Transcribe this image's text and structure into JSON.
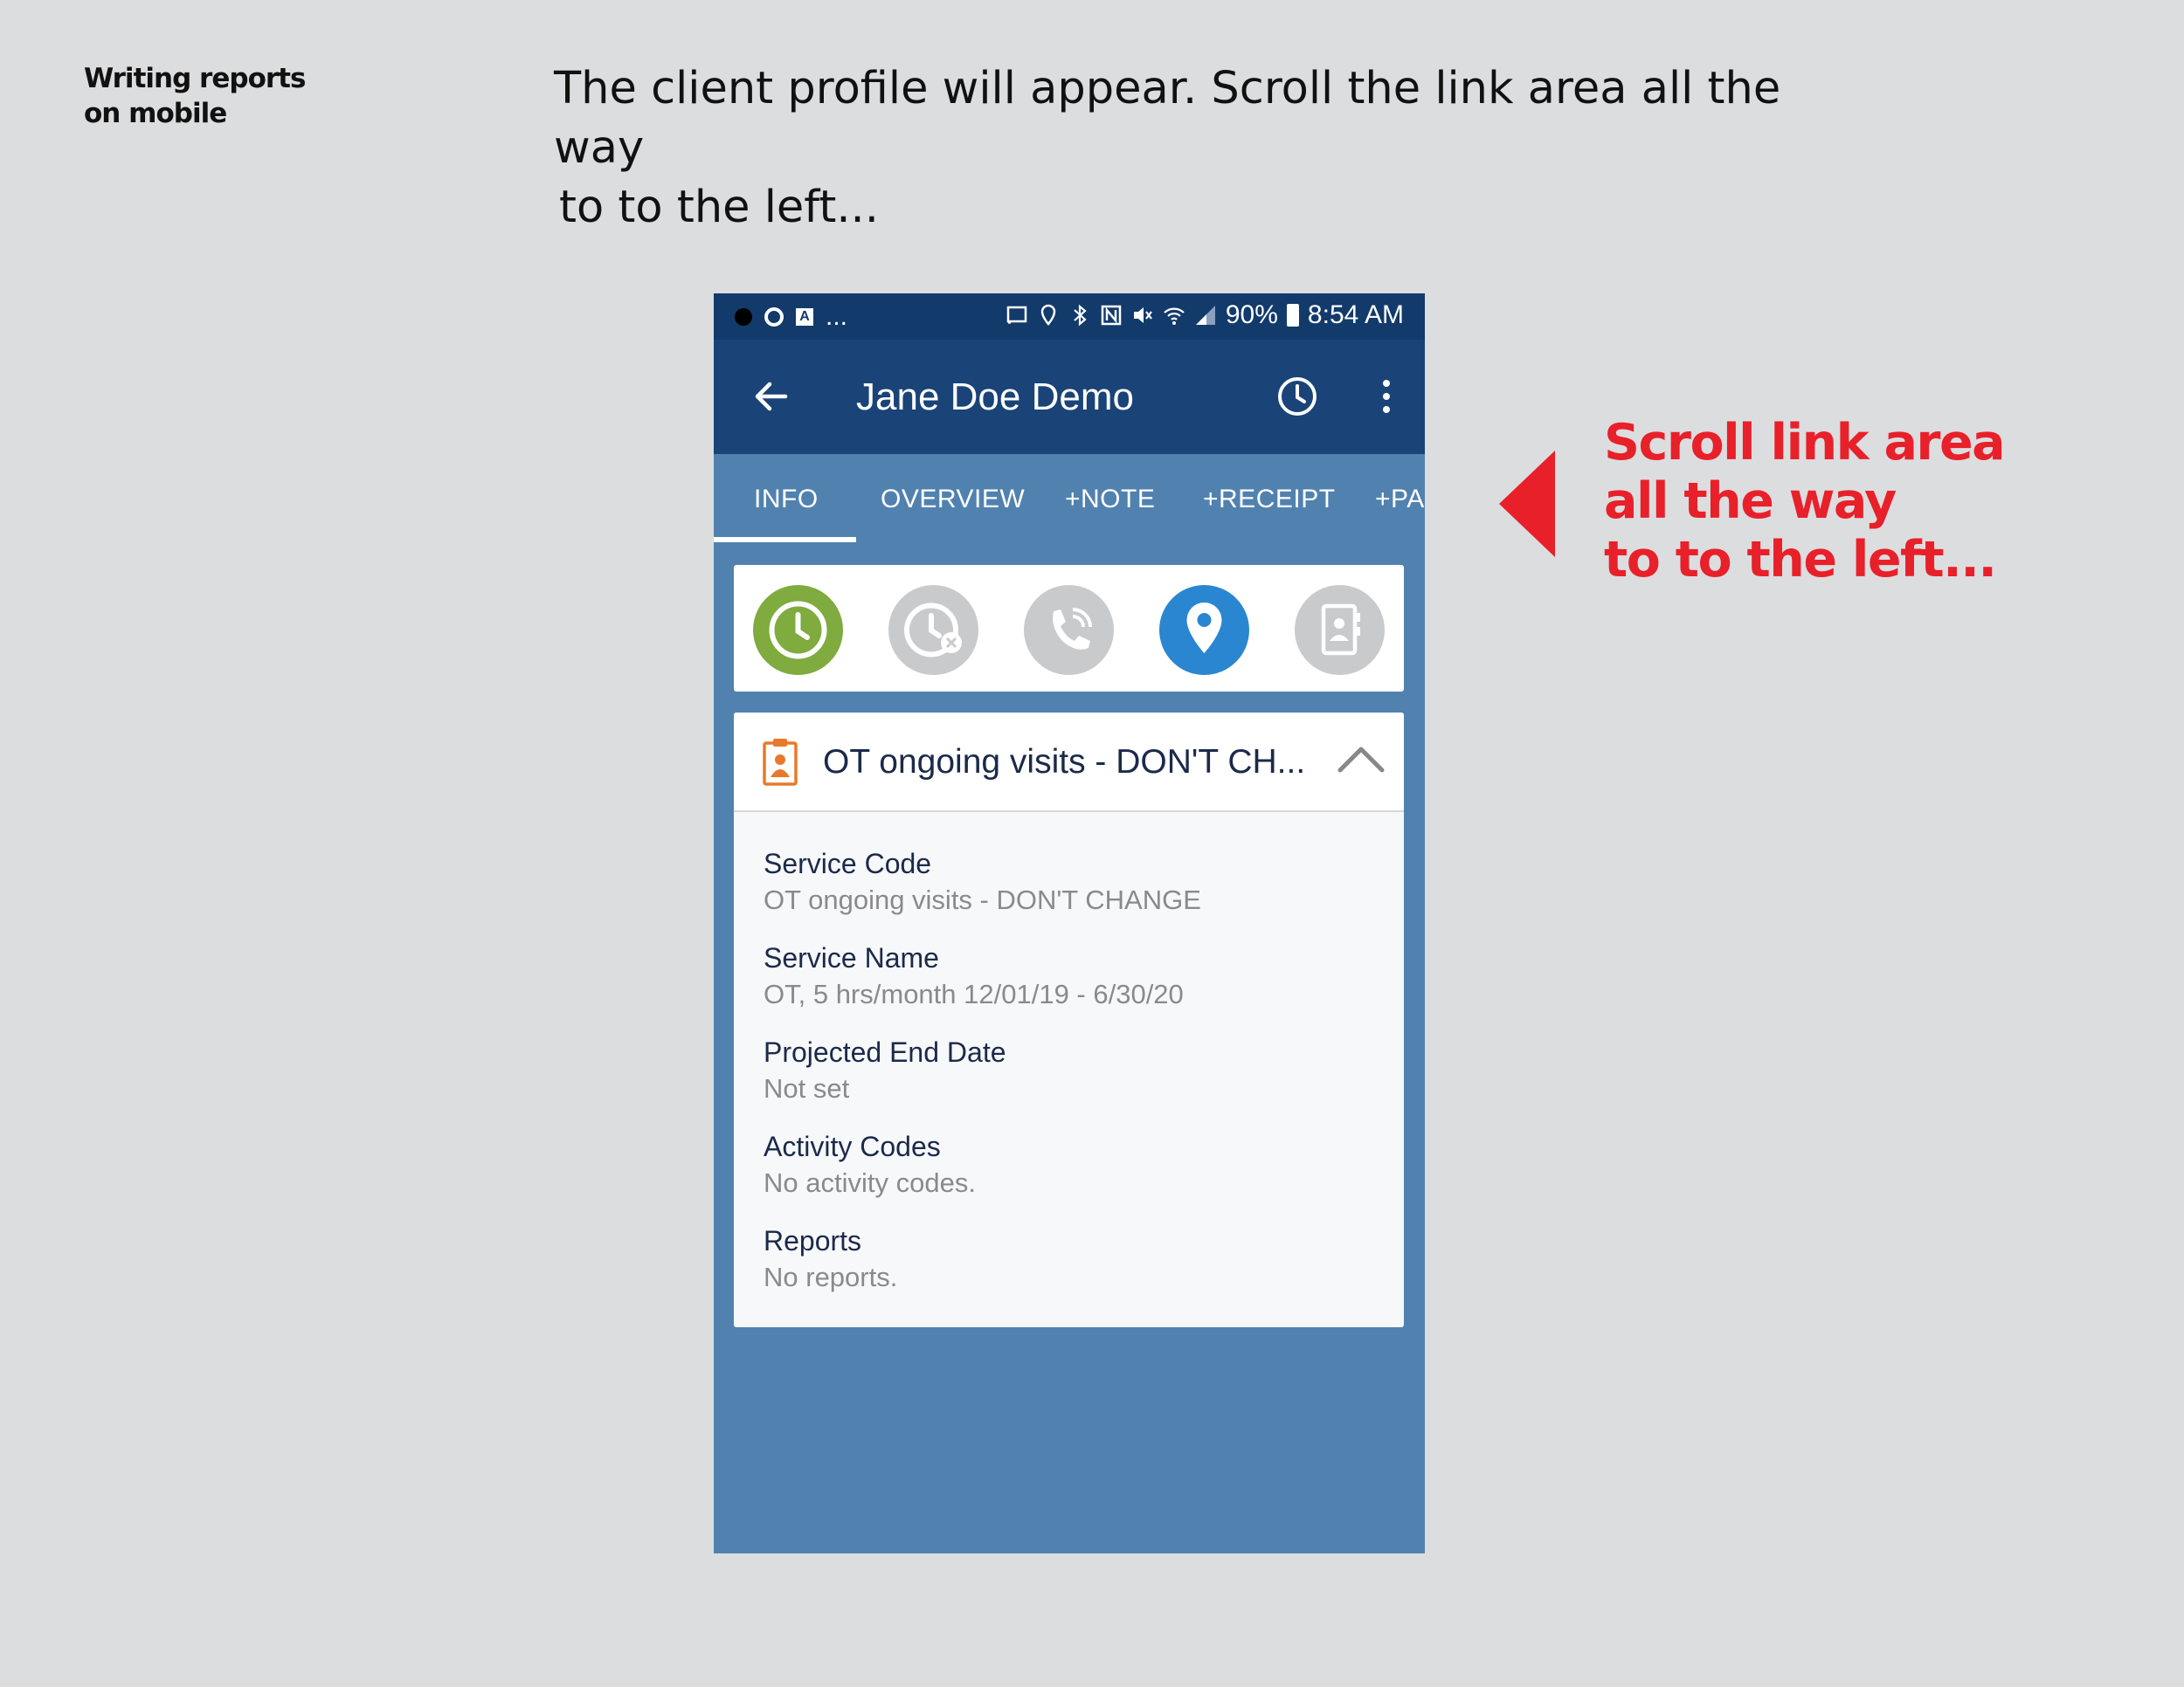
{
  "doc": {
    "side_title_line1": "Writing reports",
    "side_title_line2": "on mobile",
    "instruction_line1": "The client profile will appear. Scroll the link area all the way",
    "instruction_line2": "to to the left..."
  },
  "annotation": {
    "line1": "Scroll link area",
    "line2": "all the way",
    "line3": "to to the left...",
    "color": "#e8202a"
  },
  "status_bar": {
    "left_more": "...",
    "battery": "90%",
    "time": "8:54 AM"
  },
  "app_bar": {
    "title": "Jane Doe Demo",
    "color": "#1a4377"
  },
  "tabs": [
    {
      "label": "INFO",
      "selected": true
    },
    {
      "label": "OVERVIEW"
    },
    {
      "label": "+NOTE"
    },
    {
      "label": "+RECEIPT"
    },
    {
      "label": "+PA"
    }
  ],
  "action_icons": [
    {
      "name": "clock-in-icon",
      "color": "#7fab3f"
    },
    {
      "name": "clock-cancel-icon",
      "color": "#c9cacc"
    },
    {
      "name": "phone-icon",
      "color": "#c9cacc"
    },
    {
      "name": "location-icon",
      "color": "#2a86d0"
    },
    {
      "name": "contact-book-icon",
      "color": "#c9cacc"
    }
  ],
  "service": {
    "header_title": "OT ongoing visits - DON'T CH...",
    "fields": [
      {
        "label": "Service Code",
        "value": "OT ongoing visits - DON'T CHANGE"
      },
      {
        "label": "Service Name",
        "value": "OT, 5 hrs/month 12/01/19 - 6/30/20"
      },
      {
        "label": "Projected End Date",
        "value": "Not set"
      },
      {
        "label": "Activity Codes",
        "value": "No activity codes."
      },
      {
        "label": "Reports",
        "value": "No reports."
      }
    ]
  }
}
